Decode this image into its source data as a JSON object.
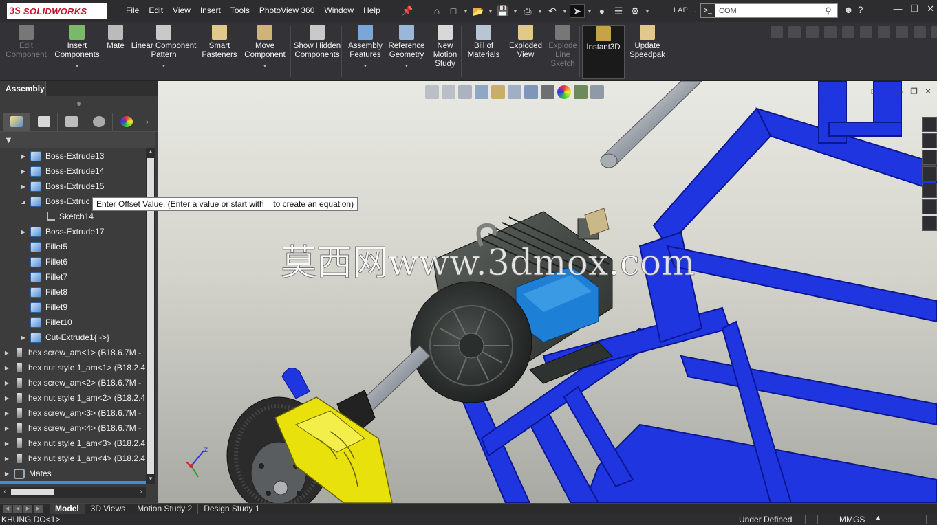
{
  "app": {
    "brand": "SOLIDWORKS",
    "brand_prefix": "3S"
  },
  "menu": [
    "File",
    "Edit",
    "View",
    "Insert",
    "Tools",
    "PhotoView 360",
    "Window",
    "Help"
  ],
  "title_bar": {
    "user_label": "LAP ...",
    "search_value": "COM",
    "search_prompt_glyph": ">_"
  },
  "ribbon": {
    "buttons": [
      {
        "id": "edit-component",
        "label": "Edit Component",
        "disabled": true,
        "caret": false
      },
      {
        "id": "insert-components",
        "label": "Insert Components",
        "disabled": false,
        "caret": true
      },
      {
        "id": "mate",
        "label": "Mate",
        "disabled": false,
        "caret": false
      },
      {
        "id": "linear-component-pattern",
        "label": "Linear Component Pattern",
        "disabled": false,
        "caret": true
      },
      {
        "id": "smart-fasteners",
        "label": "Smart Fasteners",
        "disabled": false,
        "caret": false
      },
      {
        "id": "move-component",
        "label": "Move Component",
        "disabled": false,
        "caret": true
      },
      {
        "id": "show-hidden-components",
        "label": "Show Hidden Components",
        "disabled": false,
        "caret": false
      },
      {
        "id": "assembly-features",
        "label": "Assembly Features",
        "disabled": false,
        "caret": true
      },
      {
        "id": "reference-geometry",
        "label": "Reference Geometry",
        "disabled": false,
        "caret": true
      },
      {
        "id": "new-motion-study",
        "label": "New Motion Study",
        "disabled": false,
        "caret": false
      },
      {
        "id": "bill-of-materials",
        "label": "Bill of Materials",
        "disabled": false,
        "caret": false
      },
      {
        "id": "exploded-view",
        "label": "Exploded View",
        "disabled": false,
        "caret": false
      },
      {
        "id": "explode-line-sketch",
        "label": "Explode Line Sketch",
        "disabled": true,
        "caret": false
      },
      {
        "id": "instant3d",
        "label": "Instant3D",
        "disabled": false,
        "caret": false,
        "active": true
      },
      {
        "id": "update-speedpak",
        "label": "Update Speedpak",
        "disabled": false,
        "caret": false
      }
    ]
  },
  "left_panel": {
    "tab": "Assembly",
    "tooltip": "Enter Offset Value. (Enter a value or start with = to create an equation)",
    "tree": [
      {
        "label": "Boss-Extrude13",
        "icon": "feature-icon",
        "indent": 1,
        "arrow": "collapsed"
      },
      {
        "label": "Boss-Extrude14",
        "icon": "feature-icon",
        "indent": 1,
        "arrow": "collapsed"
      },
      {
        "label": "Boss-Extrude15",
        "icon": "feature-icon",
        "indent": 1,
        "arrow": "collapsed"
      },
      {
        "label": "Boss-Extruc",
        "icon": "feature-icon",
        "indent": 1,
        "arrow": "expanded"
      },
      {
        "label": "Sketch14",
        "icon": "sketch-icon",
        "indent": 2,
        "arrow": "none"
      },
      {
        "label": "Boss-Extrude17",
        "icon": "feature-icon",
        "indent": 1,
        "arrow": "collapsed"
      },
      {
        "label": "Fillet5",
        "icon": "feature-icon",
        "indent": 1,
        "arrow": "none"
      },
      {
        "label": "Fillet6",
        "icon": "feature-icon",
        "indent": 1,
        "arrow": "none"
      },
      {
        "label": "Fillet7",
        "icon": "feature-icon",
        "indent": 1,
        "arrow": "none"
      },
      {
        "label": "Fillet8",
        "icon": "feature-icon",
        "indent": 1,
        "arrow": "none"
      },
      {
        "label": "Fillet9",
        "icon": "feature-icon",
        "indent": 1,
        "arrow": "none"
      },
      {
        "label": "Fillet10",
        "icon": "feature-icon",
        "indent": 1,
        "arrow": "none"
      },
      {
        "label": "Cut-Extrude1{ ->}",
        "icon": "feature-icon",
        "indent": 1,
        "arrow": "collapsed"
      },
      {
        "label": "hex screw_am<1> (B18.6.7M -",
        "icon": "screw-icon",
        "indent": 0,
        "arrow": "collapsed"
      },
      {
        "label": "hex nut style 1_am<1> (B18.2.4",
        "icon": "screw-icon",
        "indent": 0,
        "arrow": "collapsed"
      },
      {
        "label": "hex screw_am<2> (B18.6.7M -",
        "icon": "screw-icon",
        "indent": 0,
        "arrow": "collapsed"
      },
      {
        "label": "hex nut style 1_am<2> (B18.2.4",
        "icon": "screw-icon",
        "indent": 0,
        "arrow": "collapsed"
      },
      {
        "label": "hex screw_am<3> (B18.6.7M -",
        "icon": "screw-icon",
        "indent": 0,
        "arrow": "collapsed"
      },
      {
        "label": "hex screw_am<4> (B18.6.7M -",
        "icon": "screw-icon",
        "indent": 0,
        "arrow": "collapsed"
      },
      {
        "label": "hex nut style 1_am<3> (B18.2.4",
        "icon": "screw-icon",
        "indent": 0,
        "arrow": "collapsed"
      },
      {
        "label": "hex nut style 1_am<4> (B18.2.4",
        "icon": "screw-icon",
        "indent": 0,
        "arrow": "collapsed"
      },
      {
        "label": "Mates",
        "icon": "mates-icon",
        "indent": 0,
        "arrow": "collapsed"
      }
    ]
  },
  "graphics": {
    "watermark": "莫西网www.3dmox.com"
  },
  "bottom_tabs": [
    "Model",
    "3D Views",
    "Motion Study 2",
    "Design Study 1"
  ],
  "status": {
    "component": "KHUNG DO<1>",
    "state": "Under Defined",
    "units": "MMGS"
  },
  "colors": {
    "frame_blue": "#1a2fd6",
    "caliper_yellow": "#e8e10c",
    "motor_dark": "#3a3f3c",
    "accent_blue": "#3a8fd8"
  }
}
